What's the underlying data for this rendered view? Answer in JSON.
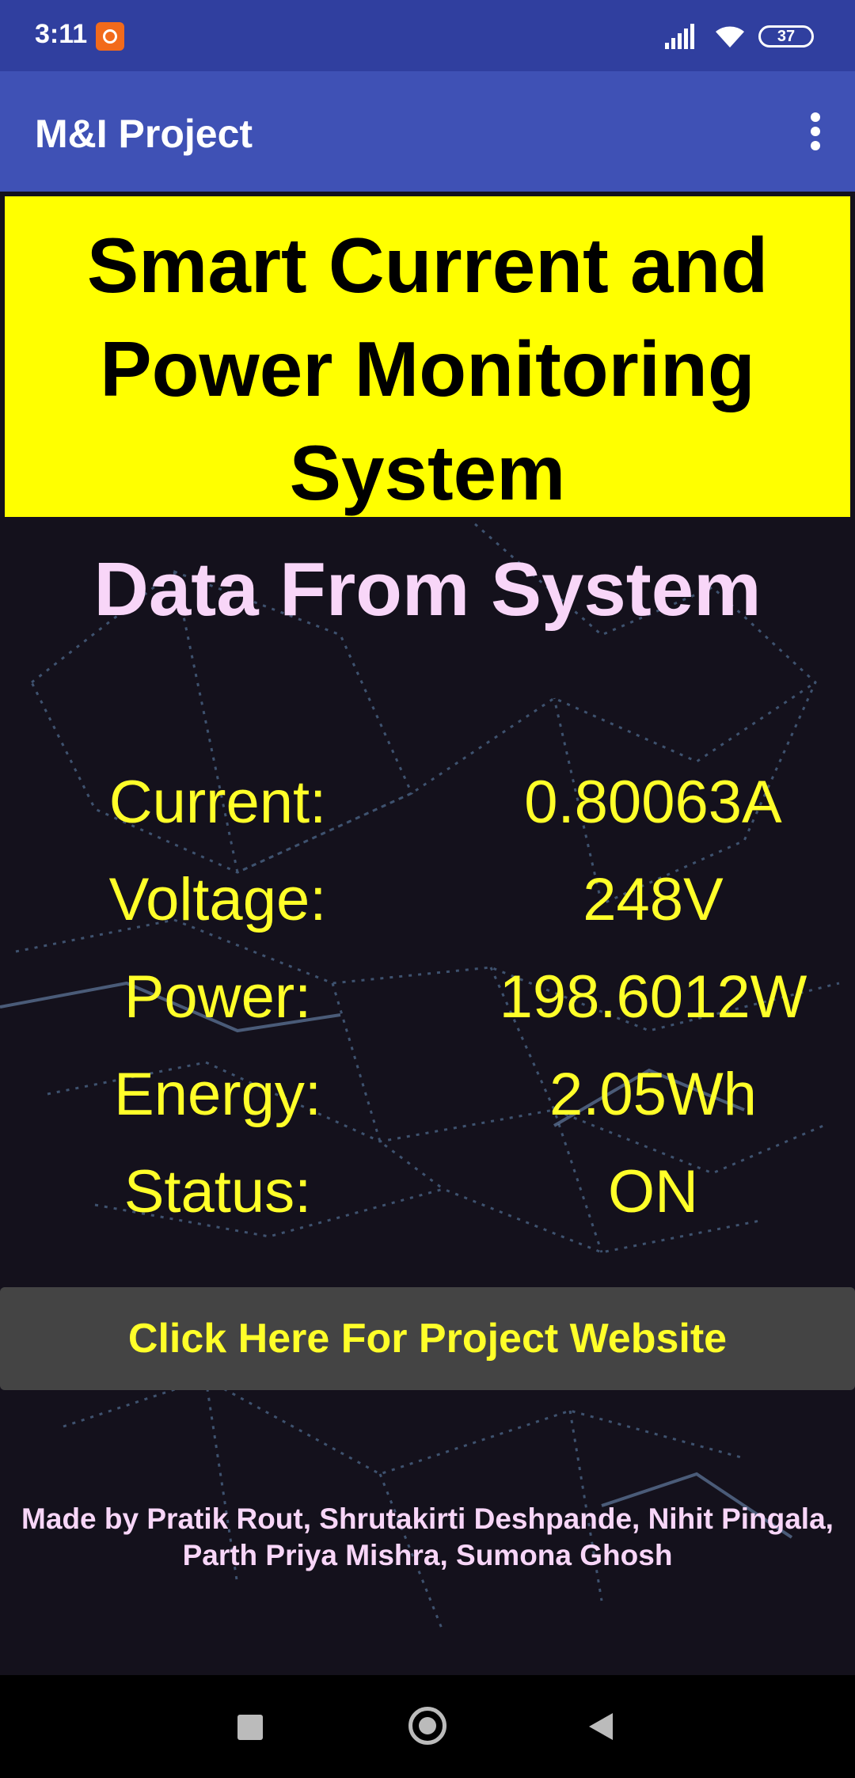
{
  "status_bar": {
    "time": "3:11",
    "battery": "37",
    "icons": [
      "mi-notification-icon",
      "signal-icon",
      "wifi-icon",
      "battery-icon"
    ]
  },
  "app_bar": {
    "title": "M&I Project",
    "menu_icon": "overflow-menu-icon"
  },
  "headline": {
    "line1": "Smart Current and",
    "line2": "Power Monitoring",
    "line3": "System",
    "background": "#ffff00"
  },
  "section_title": "Data From System",
  "readings": [
    {
      "label": "Current:",
      "value": "0.80063A"
    },
    {
      "label": "Voltage:",
      "value": "248V"
    },
    {
      "label": "Power:",
      "value": "198.6012W"
    },
    {
      "label": "Energy:",
      "value": "2.05Wh"
    },
    {
      "label": "Status:",
      "value": "ON"
    }
  ],
  "website_button": "Click Here For Project Website",
  "credits": {
    "line1": "Made by Pratik Rout, Shrutakirti Deshpande, Nihit Pingala,",
    "line2": "Parth Priya Mishra, Sumona Ghosh"
  },
  "colors": {
    "status_bar": "#303f9f",
    "app_bar": "#3f51b5",
    "reading_text": "#ffff29",
    "accent_pink": "#f8d6f8",
    "button": "#444444",
    "background": "#14111c"
  },
  "nav_bar": {
    "icons": [
      "recents-icon",
      "home-icon",
      "back-icon"
    ]
  }
}
